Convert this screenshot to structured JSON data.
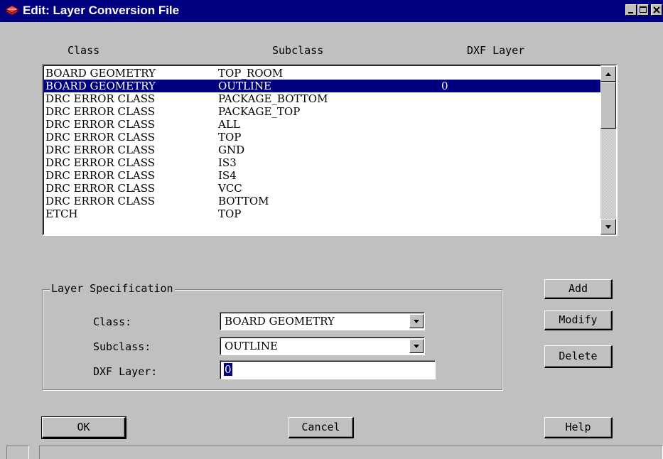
{
  "window": {
    "title": "Edit: Layer Conversion File",
    "icon": "layer-app-icon",
    "controls": [
      "minimize-icon",
      "maximize-icon",
      "close-icon"
    ]
  },
  "list": {
    "headers": {
      "class": "Class",
      "subclass": "Subclass",
      "dxf_layer": "DXF Layer"
    },
    "rows": [
      {
        "class": "BOARD GEOMETRY",
        "subclass": "TOP_ROOM",
        "dxf": ""
      },
      {
        "class": "BOARD GEOMETRY",
        "subclass": "OUTLINE",
        "dxf": "0"
      },
      {
        "class": "DRC ERROR CLASS",
        "subclass": "PACKAGE_BOTTOM",
        "dxf": ""
      },
      {
        "class": "DRC ERROR CLASS",
        "subclass": "PACKAGE_TOP",
        "dxf": ""
      },
      {
        "class": "DRC ERROR CLASS",
        "subclass": "ALL",
        "dxf": ""
      },
      {
        "class": "DRC ERROR CLASS",
        "subclass": "TOP",
        "dxf": ""
      },
      {
        "class": "DRC ERROR CLASS",
        "subclass": "GND",
        "dxf": ""
      },
      {
        "class": "DRC ERROR CLASS",
        "subclass": "IS3",
        "dxf": ""
      },
      {
        "class": "DRC ERROR CLASS",
        "subclass": "IS4",
        "dxf": ""
      },
      {
        "class": "DRC ERROR CLASS",
        "subclass": "VCC",
        "dxf": ""
      },
      {
        "class": "DRC ERROR CLASS",
        "subclass": "BOTTOM",
        "dxf": ""
      },
      {
        "class": "ETCH",
        "subclass": "TOP",
        "dxf": ""
      }
    ],
    "selected_index": 1
  },
  "layer_spec": {
    "title": "Layer Specification",
    "class_label": "Class:",
    "class_value": "BOARD GEOMETRY",
    "subclass_label": "Subclass:",
    "subclass_value": "OUTLINE",
    "dxf_label": "DXF Layer:",
    "dxf_value": "0"
  },
  "buttons": {
    "add": "Add",
    "modify": "Modify",
    "delete": "Delete",
    "ok": "OK",
    "cancel": "Cancel",
    "help": "Help"
  },
  "colors": {
    "selection": "#000080",
    "face": "#c0c0c0",
    "titlebar": "#000080"
  }
}
